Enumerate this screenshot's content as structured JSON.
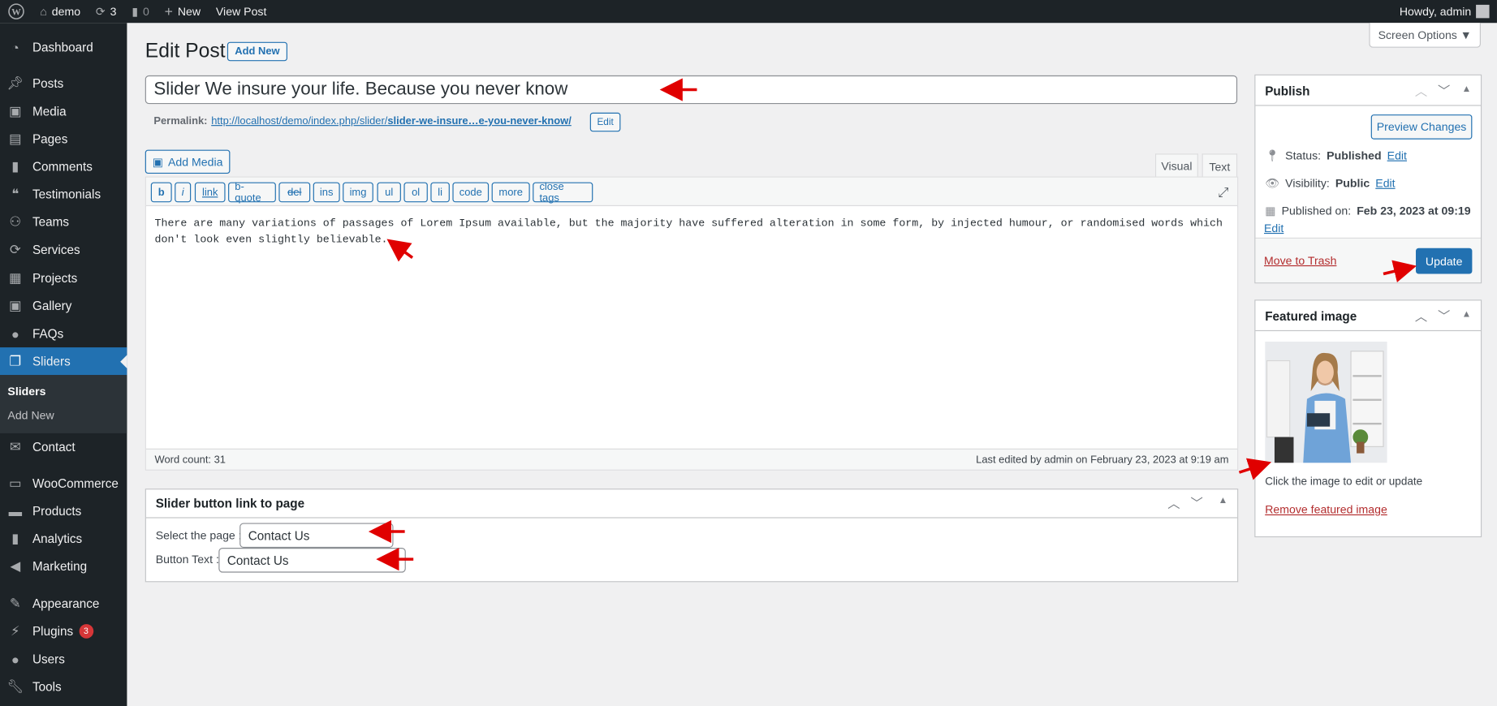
{
  "adminbar": {
    "site": "demo",
    "updates": "3",
    "comments": "0",
    "new": "New",
    "view_post": "View Post",
    "howdy": "Howdy, admin"
  },
  "sidebar": {
    "items": [
      {
        "label": "Dashboard",
        "icon": "dashboard-icon"
      },
      {
        "label": "Posts",
        "icon": "pin-icon"
      },
      {
        "label": "Media",
        "icon": "media-icon"
      },
      {
        "label": "Pages",
        "icon": "pages-icon"
      },
      {
        "label": "Comments",
        "icon": "comment-icon"
      },
      {
        "label": "Testimonials",
        "icon": "testimonial-icon"
      },
      {
        "label": "Teams",
        "icon": "groups-icon"
      },
      {
        "label": "Services",
        "icon": "services-icon"
      },
      {
        "label": "Projects",
        "icon": "portfolio-icon"
      },
      {
        "label": "Gallery",
        "icon": "gallery-icon"
      },
      {
        "label": "FAQs",
        "icon": "faq-icon"
      },
      {
        "label": "Sliders",
        "icon": "slides-icon",
        "active": true
      },
      {
        "label": "Contact",
        "icon": "email-icon"
      },
      {
        "label": "WooCommerce",
        "icon": "woo-icon"
      },
      {
        "label": "Products",
        "icon": "archive-icon"
      },
      {
        "label": "Analytics",
        "icon": "chart-icon"
      },
      {
        "label": "Marketing",
        "icon": "megaphone-icon"
      },
      {
        "label": "Appearance",
        "icon": "brush-icon"
      },
      {
        "label": "Plugins",
        "icon": "plugin-icon",
        "badge": "3"
      },
      {
        "label": "Users",
        "icon": "user-icon"
      },
      {
        "label": "Tools",
        "icon": "wrench-icon"
      }
    ],
    "submenu": [
      "Sliders",
      "Add New"
    ]
  },
  "screen_options": "Screen Options ▼",
  "page_title": "Edit Post",
  "add_new": "Add New",
  "post_title": "Slider We insure your life. Because you never know",
  "permalink": {
    "label": "Permalink:",
    "base": "http://localhost/demo/index.php/slider/",
    "slug": "slider-we-insure…e-you-never-know/",
    "edit": "Edit"
  },
  "editor": {
    "add_media": "Add Media",
    "tabs": [
      "Visual",
      "Text"
    ],
    "active_tab": "Text",
    "quicktags": [
      "b",
      "i",
      "link",
      "b-quote",
      "del",
      "ins",
      "img",
      "ul",
      "ol",
      "li",
      "code",
      "more",
      "close tags"
    ],
    "content": "There are many variations of passages of Lorem Ipsum available, but the majority have suffered alteration in some form, by injected humour, or randomised words which don't look even slightly believable.",
    "word_count": "Word count: 31",
    "last_edited": "Last edited by admin on February 23, 2023 at 9:19 am"
  },
  "slider_box": {
    "title": "Slider button link to page",
    "select_label": "Select the page :",
    "select_value": "Contact Us",
    "button_label": "Button Text :",
    "button_value": "Contact Us"
  },
  "publish": {
    "title": "Publish",
    "preview": "Preview Changes",
    "status_label": "Status:",
    "status": "Published",
    "visibility_label": "Visibility:",
    "visibility": "Public",
    "published_label": "Published on:",
    "published": "Feb 23, 2023 at 09:19",
    "edit": "Edit",
    "trash": "Move to Trash",
    "update": "Update"
  },
  "featured": {
    "title": "Featured image",
    "hint": "Click the image to edit or update",
    "remove": "Remove featured image"
  },
  "colors": {
    "accent": "#2271b1",
    "sidebar": "#1d2327",
    "danger": "#b32d2e",
    "annotation": "#e00000"
  }
}
